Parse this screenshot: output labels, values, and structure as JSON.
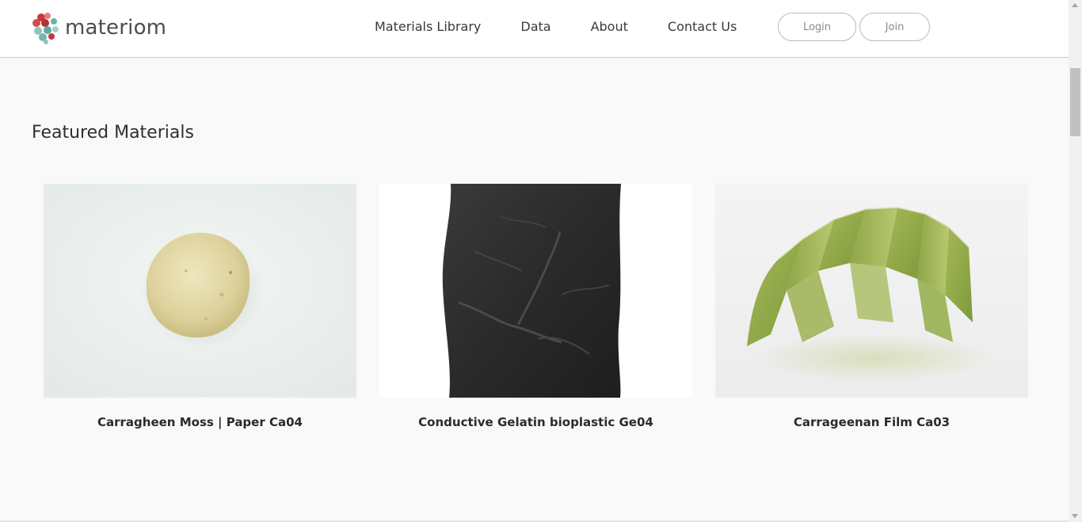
{
  "brand": {
    "name": "materiom"
  },
  "nav": {
    "items": [
      {
        "label": "Materials Library"
      },
      {
        "label": "Data"
      },
      {
        "label": "About"
      },
      {
        "label": "Contact Us"
      }
    ],
    "login_label": "Login",
    "join_label": "Join"
  },
  "featured": {
    "title": "Featured Materials",
    "cards": [
      {
        "name": "Carragheen Moss | Paper Ca04"
      },
      {
        "name": "Conductive Gelatin bioplastic Ge04"
      },
      {
        "name": "Carrageenan Film Ca03"
      }
    ]
  },
  "colors": {
    "logo_red": "#c8373e",
    "logo_teal": "#5fa9a3",
    "header_bg": "#ffffff",
    "page_bg": "#f9f9f9"
  }
}
